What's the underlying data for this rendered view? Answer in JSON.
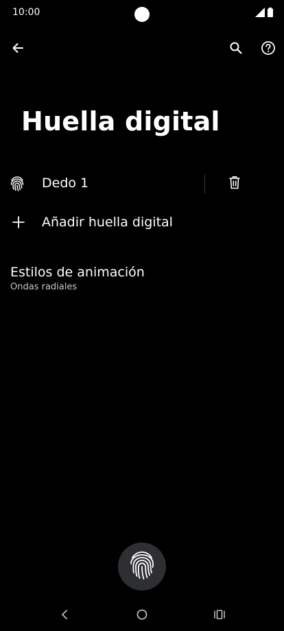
{
  "status_bar": {
    "time": "10:00",
    "icons": [
      "signal-icon",
      "battery-icon"
    ]
  },
  "toolbar": {
    "icons": [
      "arrow-back-icon",
      "search-icon",
      "help-icon"
    ]
  },
  "page": {
    "title": "Huella digital"
  },
  "fingerprints": [
    {
      "label": "Dedo 1",
      "icon": "fingerprint-icon",
      "action_icon": "trash-icon"
    }
  ],
  "add_fingerprint": {
    "label": "Añadir huella digital",
    "icon": "plus-icon"
  },
  "animation_styles": {
    "title": "Estilos de animación",
    "value": "Ondas radiales"
  },
  "sensor": {
    "icon": "fingerprint-sensor-icon",
    "background": "#2e2f33"
  },
  "nav_bar": {
    "icons": [
      "nav-back-icon",
      "nav-home-icon",
      "nav-recents-icon"
    ]
  },
  "colors": {
    "background": "#000000",
    "text_primary": "#ffffff",
    "text_secondary": "#c8c8c8"
  }
}
